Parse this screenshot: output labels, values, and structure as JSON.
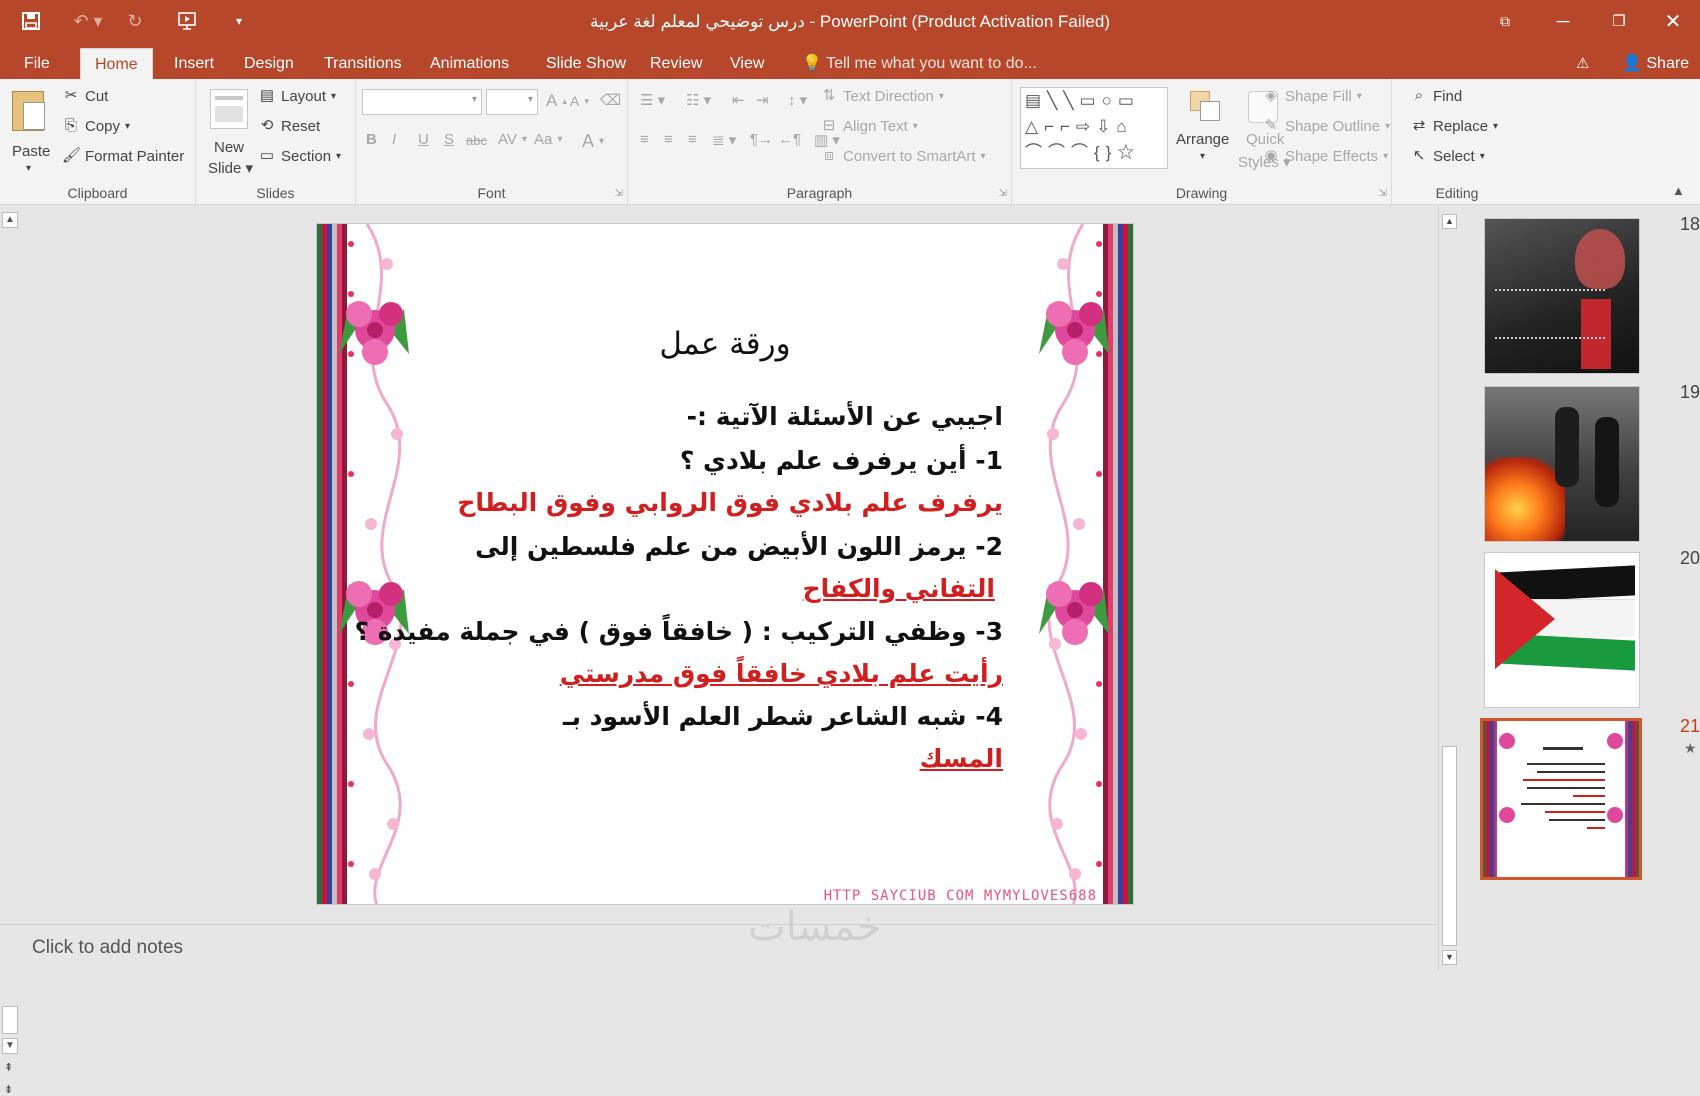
{
  "window": {
    "title": "درس توضيحي لمعلم لغة عربية - PowerPoint (Product Activation Failed)",
    "qat": [
      "save-icon",
      "undo-icon",
      "redo-icon",
      "start-from-beginning-icon",
      "customize-icon"
    ],
    "controls": [
      "ribbon-display-icon",
      "minimize-icon",
      "restore-icon",
      "close-icon"
    ]
  },
  "tabs": [
    "File",
    "Home",
    "Insert",
    "Design",
    "Transitions",
    "Animations",
    "Slide Show",
    "Review",
    "View"
  ],
  "active_tab": "Home",
  "tell_me": "Tell me what you want to do...",
  "share": "Share",
  "ribbon": {
    "clipboard": {
      "label": "Clipboard",
      "paste": "Paste",
      "cut": "Cut",
      "copy": "Copy",
      "format_painter": "Format Painter"
    },
    "slides": {
      "label": "Slides",
      "new_slide_1": "New",
      "new_slide_2": "Slide",
      "layout": "Layout",
      "reset": "Reset",
      "section": "Section"
    },
    "font": {
      "label": "Font",
      "bold": "B",
      "italic": "I",
      "underline": "U",
      "strike": "S",
      "abc": "abc",
      "spacing": "AV",
      "case": "Aa",
      "color": "A",
      "grow": "A",
      "shrink": "A"
    },
    "paragraph": {
      "label": "Paragraph",
      "text_direction": "Text Direction",
      "align_text": "Align Text",
      "smartart": "Convert to SmartArt"
    },
    "drawing": {
      "label": "Drawing",
      "arrange": "Arrange",
      "quick_1": "Quick",
      "quick_2": "Styles",
      "shape_fill": "Shape Fill",
      "shape_outline": "Shape Outline",
      "shape_effects": "Shape Effects"
    },
    "editing": {
      "label": "Editing",
      "find": "Find",
      "replace": "Replace",
      "select": "Select"
    }
  },
  "slide": {
    "title": "ورقة عمل",
    "lines": [
      {
        "text": "اجيبي عن الأسئلة الآتية :-",
        "style": "black"
      },
      {
        "text": "1- أين يرفرف علم بلادي ؟",
        "style": "black"
      },
      {
        "text": "يرفرف علم بلادي فوق الروابي وفوق البطاح",
        "style": "red"
      },
      {
        "text": "2- يرمز اللون الأبيض من علم فلسطين إلى",
        "style": "black"
      },
      {
        "text": "التفاني والكفاح",
        "style": "red-ul"
      },
      {
        "text": "3- وظفي التركيب : ( خافقاً فوق ) في جملة مفيدة ؟",
        "style": "black"
      },
      {
        "text": "رأيت علم بلادي خافقاً فوق مدرستي",
        "style": "red-ul"
      },
      {
        "text": "4- شبه الشاعر شطر العلم الأسود بـ",
        "style": "black"
      },
      {
        "text": "المسك",
        "style": "red-ul"
      }
    ],
    "watermark": "HTTP SAYCIUB COM MYMYLOVES688"
  },
  "thumbnails": [
    {
      "num": "18",
      "kind": "photo-dark"
    },
    {
      "num": "19",
      "kind": "photo-fire"
    },
    {
      "num": "20",
      "kind": "flag"
    },
    {
      "num": "21",
      "kind": "worksheet",
      "selected": true
    }
  ],
  "thumb_star": "★",
  "notes_placeholder": "Click to add notes",
  "site_watermark": "خمسات",
  "colors": {
    "accent": "#b7472a",
    "red_text": "#d11e1e",
    "selection": "#d2572b"
  }
}
